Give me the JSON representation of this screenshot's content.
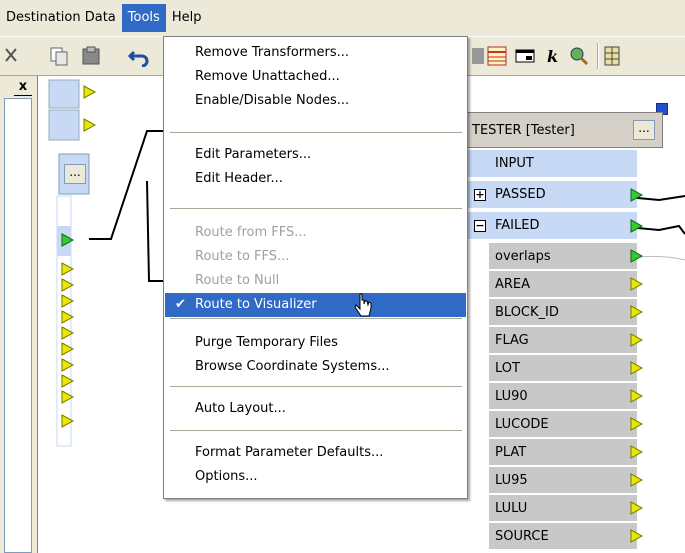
{
  "menubar": {
    "items": [
      "Destination Data",
      "Tools",
      "Help"
    ]
  },
  "left_panel": {
    "close_label": "x"
  },
  "tools_menu": {
    "groups": [
      [
        "Remove Transformers...",
        "Remove Unattached...",
        "Enable/Disable Nodes..."
      ],
      [
        "Edit Parameters...",
        "Edit Header..."
      ],
      [
        "Route from FFS...",
        "Route to FFS...",
        "Route to Null",
        "Route to Visualizer"
      ],
      [
        "Purge Temporary Files",
        "Browse Coordinate Systems..."
      ],
      [
        "Auto Layout..."
      ],
      [
        "Format Parameter Defaults...",
        "Options..."
      ]
    ],
    "disabled": [
      "Route from FFS...",
      "Route to FFS...",
      "Route to Null"
    ],
    "checked": "Route to Visualizer",
    "highlighted": "Route to Visualizer"
  },
  "tester": {
    "title": "TESTER [Tester]",
    "dots": "...",
    "input_label": "INPUT",
    "passed_label": "PASSED",
    "failed_label": "FAILED",
    "attributes": [
      "overlaps",
      "AREA",
      "BLOCK_ID",
      "FLAG",
      "LOT",
      "LU90",
      "LUCODE",
      "PLAT",
      "LU95",
      "LULU",
      "SOURCE"
    ]
  },
  "left_node": {
    "dots": "..."
  },
  "colors": {
    "menu_highlight": "#316ac5",
    "chrome": "#ece9d8",
    "port_blue": "#c7d9f4",
    "attr_gray": "#c8c8c8",
    "port_yellow": "#d8d800",
    "port_green": "#33cc33"
  }
}
